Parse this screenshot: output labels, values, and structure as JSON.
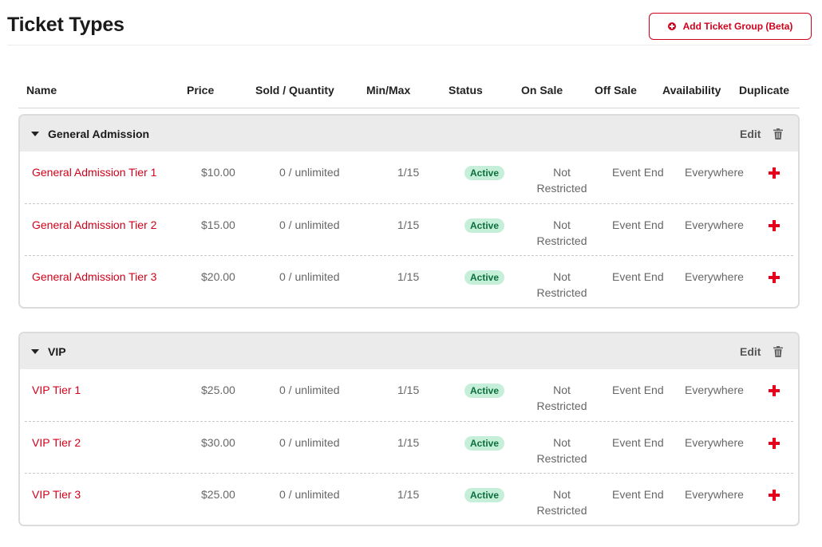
{
  "page": {
    "title": "Ticket Types",
    "add_button_label": "Add Ticket Group (Beta)"
  },
  "columns": [
    "Name",
    "Price",
    "Sold / Quantity",
    "Min/Max",
    "Status",
    "On Sale",
    "Off Sale",
    "Availability",
    "Duplicate"
  ],
  "groups": [
    {
      "name": "General Admission",
      "edit_label": "Edit",
      "rows": [
        {
          "name": "General Admission Tier 1",
          "price": "$10.00",
          "sold": "0 / unlimited",
          "minmax": "1/15",
          "status": "Active",
          "on_sale": "Not Restricted",
          "off_sale": "Event End",
          "availability": "Everywhere"
        },
        {
          "name": "General Admission Tier 2",
          "price": "$15.00",
          "sold": "0 / unlimited",
          "minmax": "1/15",
          "status": "Active",
          "on_sale": "Not Restricted",
          "off_sale": "Event End",
          "availability": "Everywhere"
        },
        {
          "name": "General Admission Tier 3",
          "price": "$20.00",
          "sold": "0 / unlimited",
          "minmax": "1/15",
          "status": "Active",
          "on_sale": "Not Restricted",
          "off_sale": "Event End",
          "availability": "Everywhere"
        }
      ]
    },
    {
      "name": "VIP",
      "edit_label": "Edit",
      "rows": [
        {
          "name": "VIP Tier 1",
          "price": "$25.00",
          "sold": "0 / unlimited",
          "minmax": "1/15",
          "status": "Active",
          "on_sale": "Not Restricted",
          "off_sale": "Event End",
          "availability": "Everywhere"
        },
        {
          "name": "VIP Tier 2",
          "price": "$30.00",
          "sold": "0 / unlimited",
          "minmax": "1/15",
          "status": "Active",
          "on_sale": "Not Restricted",
          "off_sale": "Event End",
          "availability": "Everywhere"
        },
        {
          "name": "VIP Tier 3",
          "price": "$25.00",
          "sold": "0 / unlimited",
          "minmax": "1/15",
          "status": "Active",
          "on_sale": "Not Restricted",
          "off_sale": "Event End",
          "availability": "Everywhere"
        }
      ]
    }
  ],
  "icons": {
    "group_toggle": "caret-down-icon",
    "delete": "trash-icon",
    "duplicate": "plus-icon",
    "add": "plus-circle-icon"
  },
  "colors": {
    "accent": "#d0021b",
    "badge_bg": "#c6efd9",
    "badge_text": "#0c6e3c",
    "group_header_bg": "#ebebeb"
  }
}
